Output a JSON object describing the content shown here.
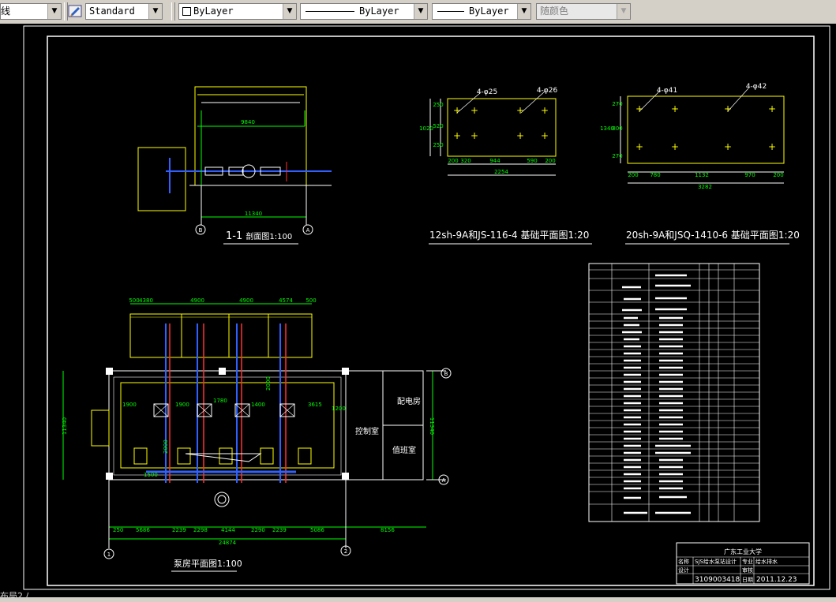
{
  "toolbar": {
    "linetype_partial": "线",
    "textstyle": "Standard",
    "layer": "ByLayer",
    "linetype": "ByLayer",
    "lineweight": "ByLayer",
    "color": "随颜色"
  },
  "drawing": {
    "section_title": "1-1",
    "section_title_suffix": "剖面图1:100",
    "section_width_dim": "11340",
    "section_inner_dim": "9840",
    "axis_b": "B",
    "axis_a": "A",
    "axis_1": "1",
    "axis_2": "2",
    "pump1_title": "12sh-9A和JS-116-4 基础平面图1:20",
    "pump1_dims_bottom": [
      "200",
      "320",
      "944",
      "590",
      "200"
    ],
    "pump1_total": "2254",
    "pump1_left_dims": [
      "250",
      "520",
      "250"
    ],
    "pump1_height": "1020",
    "pump1_hole_a": "4-φ25",
    "pump1_hole_b": "4-φ26",
    "pump2_title": "20sh-9A和JSQ-1410-6 基础平面图1:20",
    "pump2_dims_bottom": [
      "200",
      "780",
      "1132",
      "970",
      "200"
    ],
    "pump2_total": "3282",
    "pump2_left_dims": [
      "270",
      "800",
      "270"
    ],
    "pump2_height": "1340",
    "pump2_hole_a": "4-φ41",
    "pump2_hole_b": "4-φ42",
    "plan_title": "泵房平面图1:100",
    "plan_total": "24874",
    "plan_bottom_dims": [
      "250",
      "5686",
      "2239",
      "2298",
      "4144",
      "2290",
      "2239",
      "5086",
      "8156"
    ],
    "plan_top_dims": [
      "500",
      "4380",
      "4900",
      "4900",
      "4574",
      "500"
    ],
    "plan_height": "11340",
    "plan_inner_labels": [
      "1900",
      "1900",
      "1400",
      "3615",
      "1780",
      "2000",
      "1200",
      "2000",
      "1500"
    ],
    "room_control": "控制室",
    "room_power": "配电房",
    "room_duty": "值班室",
    "titleblock": {
      "school": "广东工业大学",
      "name_label": "名称",
      "project": "SJS给水泵站设计",
      "major_label": "专业",
      "major": "给水排水",
      "designer_label": "设计",
      "reviewer_label": "审核",
      "student_id": "3109003418",
      "date_label": "日期",
      "date": "2011.12.23"
    }
  },
  "status": {
    "text": "布局2 /"
  }
}
